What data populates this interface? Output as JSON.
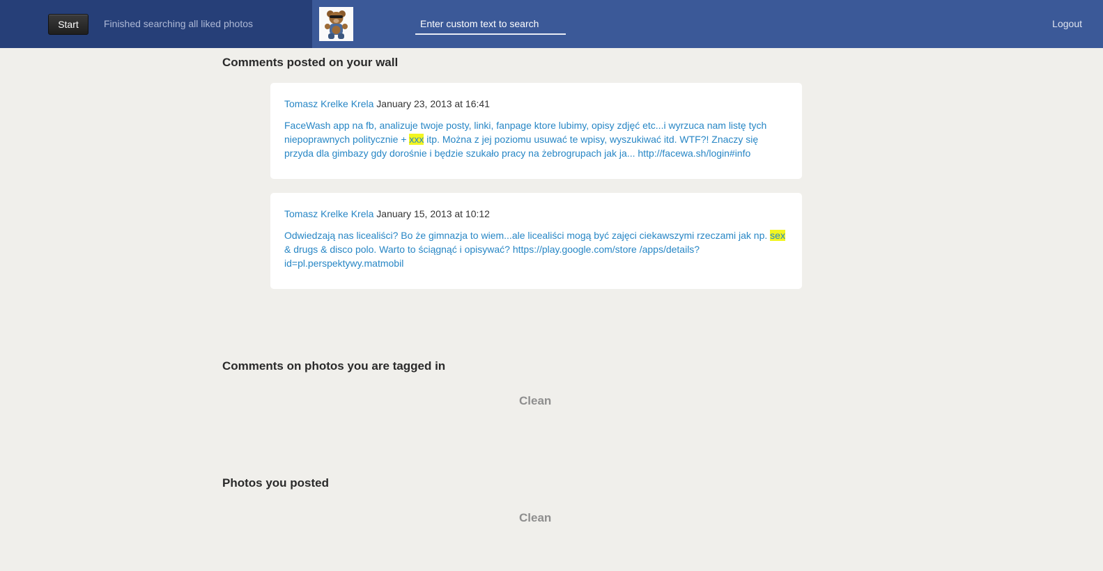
{
  "header": {
    "start_label": "Start",
    "status": "Finished searching all liked photos",
    "search_placeholder": "Enter custom text to search",
    "logout_label": "Logout",
    "avatar_icon": "teddy-bear-avatar",
    "colors": {
      "bar": "#3b5998",
      "bar_left": "#263f78"
    }
  },
  "sections": {
    "wall": {
      "title": "Comments posted on your wall",
      "comments": [
        {
          "author": "Tomasz Krelke Krela",
          "date": "January 23, 2013 at 16:41",
          "text_before": "FaceWash app na fb, analizuje twoje posty, linki, fanpage ktore lubimy, opisy zdjęć etc...i wyrzuca nam listę tych niepoprawnych politycznie + ",
          "highlight": "xxx",
          "text_after": " itp. Można z jej poziomu usuwać te wpisy, wyszukiwać itd. WTF?! Znaczy się przyda dla gimbazy gdy dorośnie i będzie szukało pracy na żebrogrupach jak ja... http://facewa.sh/login#info"
        },
        {
          "author": "Tomasz Krelke Krela",
          "date": "January 15, 2013 at 10:12",
          "text_before": "Odwiedzają nas licealiści? Bo że gimnazja to wiem...ale licealiści mogą być zajęci ciekawszymi rzeczami jak np. ",
          "highlight": "sex",
          "text_after": " & drugs & disco polo. Warto to ściągnąć i opisywać? https://play.google.com/store /apps/details?id=pl.perspektywy.matmobil"
        }
      ]
    },
    "tagged": {
      "title": "Comments on photos you are tagged in",
      "result": "Clean"
    },
    "posted": {
      "title": "Photos you posted",
      "result": "Clean"
    }
  },
  "colors": {
    "link": "#2786c5",
    "highlight": "#f2f521",
    "background": "#f0efeb"
  }
}
